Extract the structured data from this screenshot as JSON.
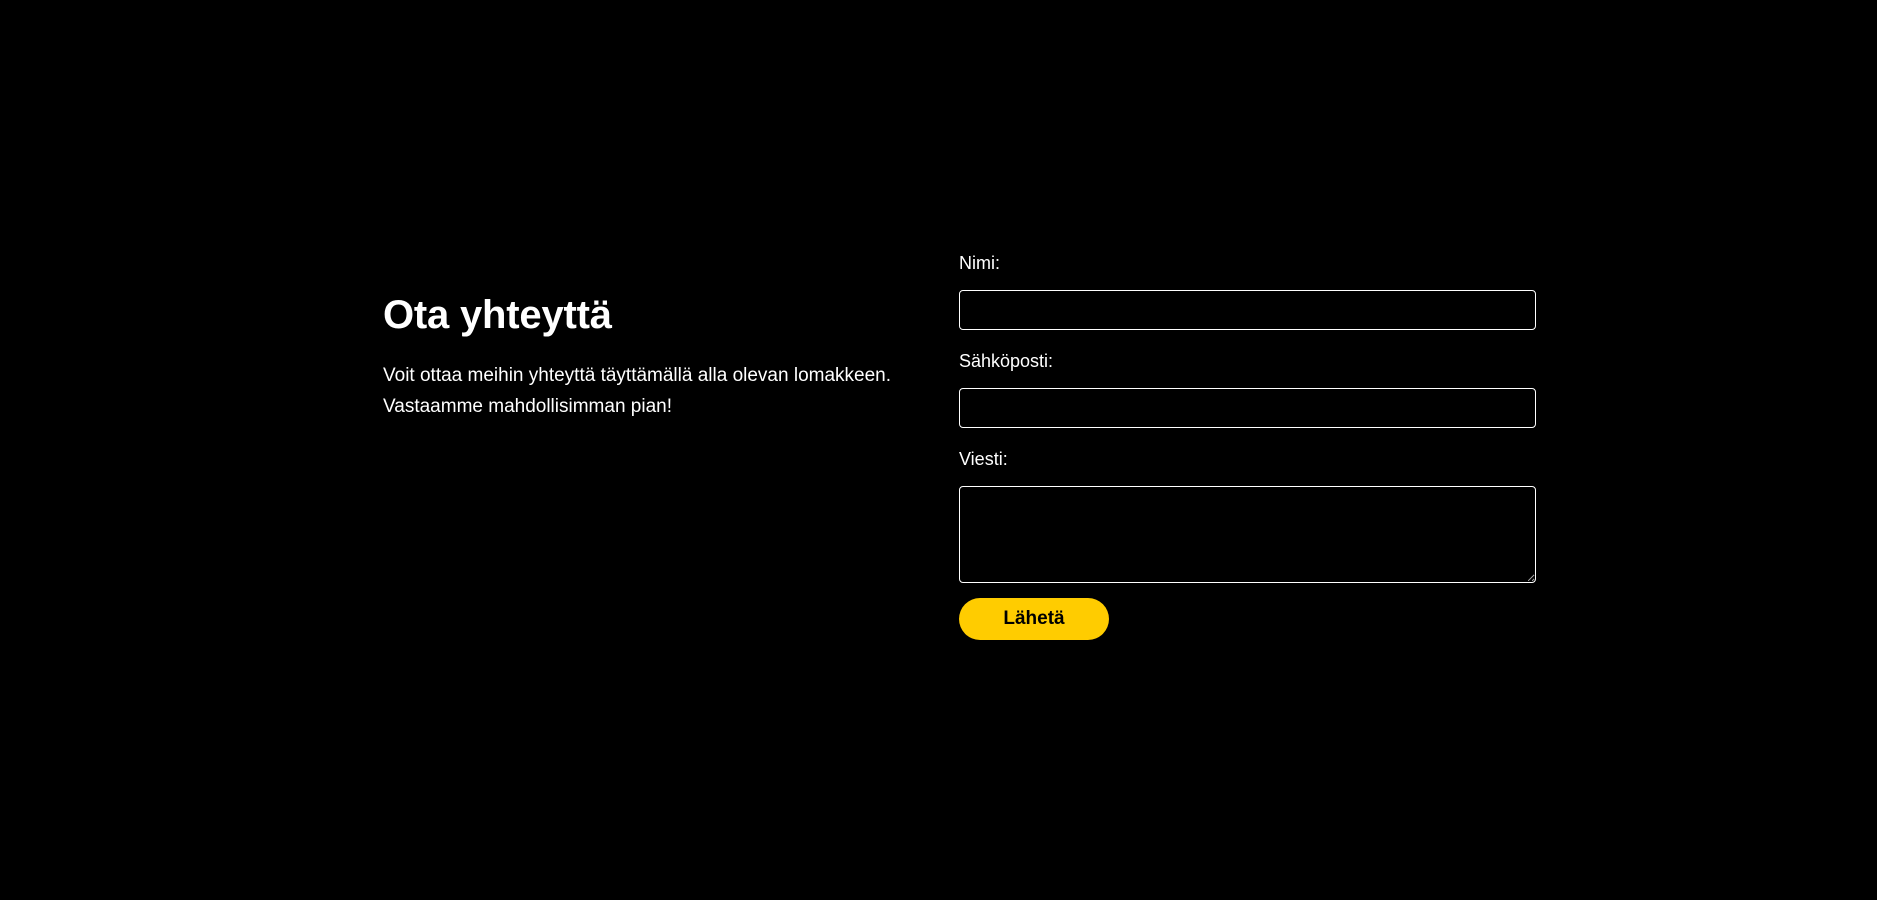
{
  "intro": {
    "title": "Ota yhteyttä",
    "line1": "Voit ottaa meihin yhteyttä täyttämällä alla olevan lomakkeen.",
    "line2": "Vastaamme mahdollisimman pian!"
  },
  "form": {
    "name_label": "Nimi:",
    "name_value": "",
    "email_label": "Sähköposti:",
    "email_value": "",
    "message_label": "Viesti:",
    "message_value": "",
    "submit_label": "Lähetä"
  },
  "colors": {
    "background": "#000000",
    "text": "#ffffff",
    "accent": "#ffcc00"
  }
}
